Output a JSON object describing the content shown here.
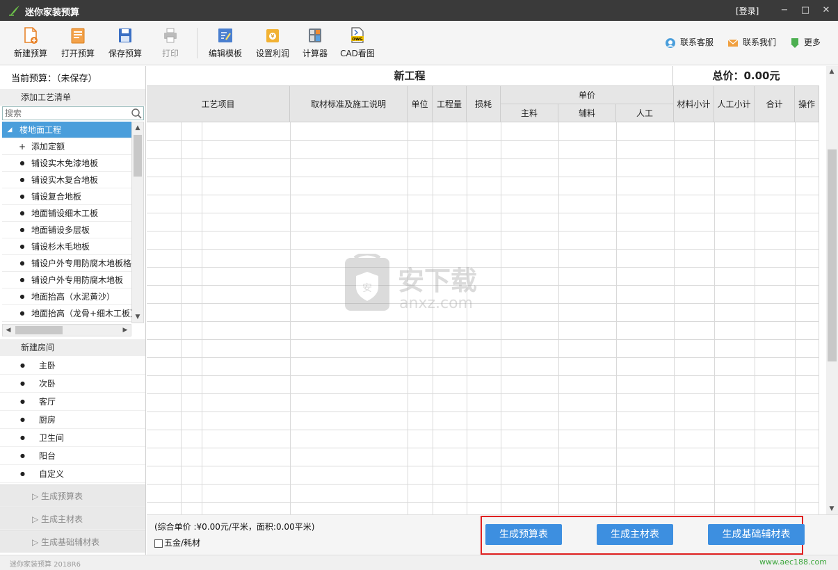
{
  "window": {
    "title": "迷你家装预算",
    "login": "[登录]",
    "minimize": "−",
    "maximize": "□",
    "close": "✕"
  },
  "toolbar": {
    "buttons": [
      {
        "label": "新建预算",
        "icon": "new-file-icon"
      },
      {
        "label": "打开预算",
        "icon": "open-folder-icon"
      },
      {
        "label": "保存预算",
        "icon": "save-disk-icon"
      },
      {
        "label": "打印",
        "icon": "printer-icon",
        "disabled": true
      },
      {
        "label": "编辑模板",
        "icon": "edit-template-icon"
      },
      {
        "label": "设置利润",
        "icon": "money-bag-icon"
      },
      {
        "label": "计算器",
        "icon": "calculator-icon"
      },
      {
        "label": "CAD看图",
        "icon": "dwg-file-icon"
      }
    ],
    "right_links": [
      {
        "label": "联系客服",
        "icon": "customer-service-icon"
      },
      {
        "label": "联系我们",
        "icon": "mail-icon"
      },
      {
        "label": "更多",
        "icon": "more-down-icon"
      }
    ]
  },
  "sidebar": {
    "current_budget": "当前预算：（未保存）",
    "craft_list_title": "添加工艺清单",
    "search_placeholder": "搜索",
    "tree": [
      {
        "mark": "◢",
        "label": "楼地面工程",
        "selected": true,
        "level": 0
      },
      {
        "mark": "+",
        "label": "添加定额",
        "level": 1
      },
      {
        "mark": "●",
        "label": "铺设实木免漆地板",
        "level": 1
      },
      {
        "mark": "●",
        "label": "铺设实木复合地板",
        "level": 1
      },
      {
        "mark": "●",
        "label": "铺设复合地板",
        "level": 1
      },
      {
        "mark": "●",
        "label": "地面铺设细木工板",
        "level": 1
      },
      {
        "mark": "●",
        "label": "地面铺设多层板",
        "level": 1
      },
      {
        "mark": "●",
        "label": "铺设杉木毛地板",
        "level": 1
      },
      {
        "mark": "●",
        "label": "铺设户外专用防腐木地板格",
        "level": 1
      },
      {
        "mark": "●",
        "label": "铺设户外专用防腐木地板",
        "level": 1
      },
      {
        "mark": "●",
        "label": "地面抬高（水泥黄沙）",
        "level": 1
      },
      {
        "mark": "●",
        "label": "地面抬高（龙骨+细木工板）",
        "level": 1
      }
    ],
    "new_room_title": "新建房间",
    "rooms": [
      "主卧",
      "次卧",
      "客厅",
      "厨房",
      "卫生间",
      "阳台",
      "自定义"
    ],
    "generate": [
      "生成预算表",
      "生成主材表",
      "生成基础辅材表"
    ]
  },
  "main": {
    "project_title": "新工程",
    "total_price": "总价：0.00元",
    "columns": {
      "craft": "工艺项目",
      "standard": "取材标准及施工说明",
      "unit": "单位",
      "quantity": "工程量",
      "loss": "损耗",
      "unit_price": "单价",
      "main_material": "主料",
      "aux_material": "辅料",
      "labor": "人工",
      "material_subtotal": "材料小计",
      "labor_subtotal": "人工小计",
      "total": "合计",
      "action": "操作"
    },
    "watermark_text": "安下载",
    "watermark_sub": "anxz.com"
  },
  "footer": {
    "summary": "(综合单价 :¥0.00元/平米，面积:0.00平米)",
    "hardware_checkbox": "五金/耗材",
    "buttons": [
      "生成预算表",
      "生成主材表",
      "生成基础辅材表"
    ]
  },
  "status": {
    "version": "迷你家装预算 2018R6",
    "site": "www.aec188.com"
  },
  "colors": {
    "titlebar": "#3a3a3a",
    "selected": "#4a9edb",
    "button": "#3d8fe0",
    "highlight": "#e02020",
    "site_link": "#3aa63a"
  }
}
